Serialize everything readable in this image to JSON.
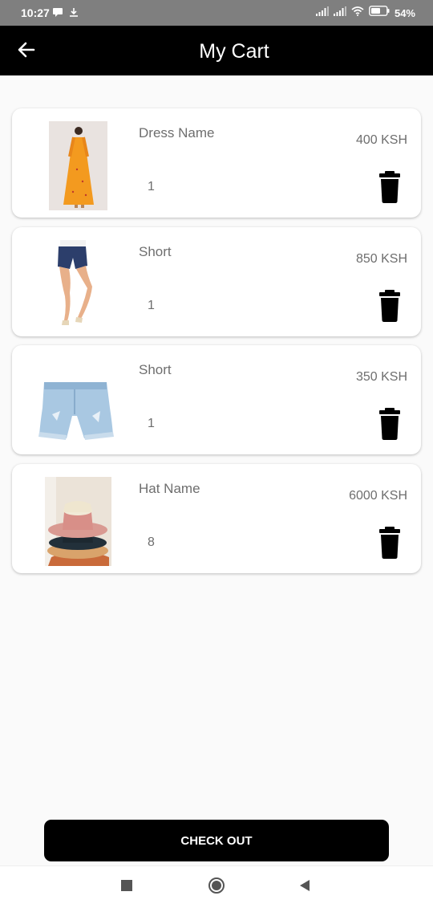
{
  "status_bar": {
    "time": "10:27",
    "battery": "54%",
    "icons": [
      "notification-icon",
      "download-icon",
      "signal-icon",
      "signal-icon",
      "wifi-icon",
      "battery-icon"
    ]
  },
  "app_bar": {
    "title": "My Cart",
    "back_icon": "arrow-left-icon"
  },
  "cart": {
    "items": [
      {
        "name": "Dress Name",
        "quantity": "1",
        "price": "400 KSH",
        "image": "orange-dress-photo"
      },
      {
        "name": "Short",
        "quantity": "1",
        "price": "850 KSH",
        "image": "denim-shorts-model-photo"
      },
      {
        "name": "Short",
        "quantity": "1",
        "price": "350 KSH",
        "image": "light-denim-shorts-photo"
      },
      {
        "name": "Hat Name",
        "quantity": "8",
        "price": "6000 KSH",
        "image": "stacked-hats-photo"
      }
    ],
    "delete_icon": "trash-icon"
  },
  "checkout": {
    "label": "CHECK OUT"
  },
  "nav_bar": {
    "icons": [
      "recents-square-icon",
      "home-circle-icon",
      "back-triangle-icon"
    ]
  },
  "colors": {
    "app_bar": "#000000",
    "background": "#fafafa",
    "status_bar": "#7f7f7f",
    "text_muted": "#6e6e6e",
    "card": "#ffffff"
  }
}
